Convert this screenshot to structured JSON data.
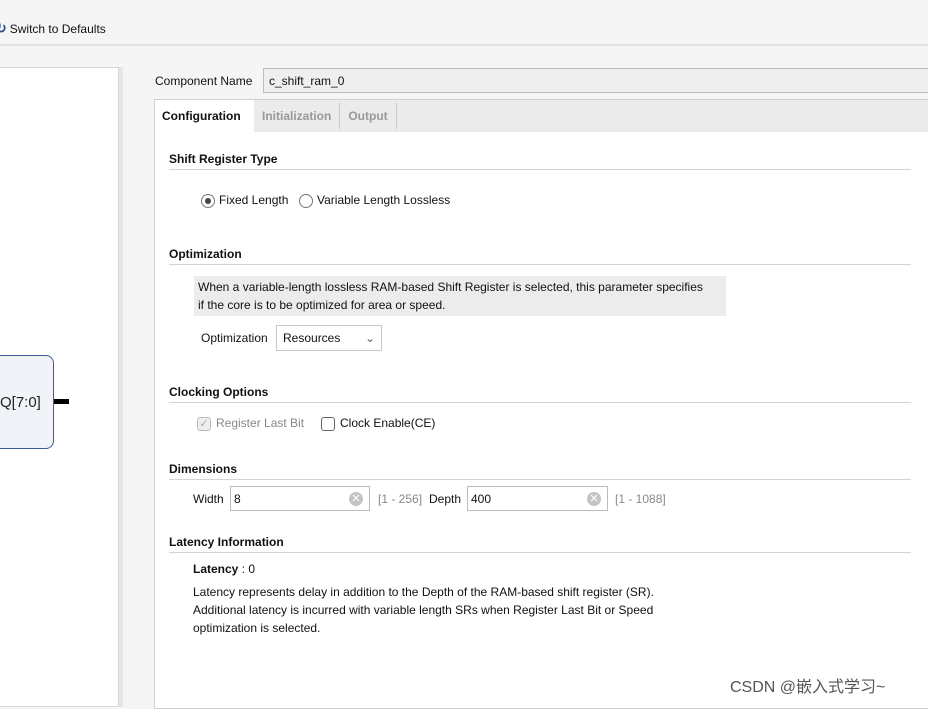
{
  "toolbar": {
    "switch_defaults": "Switch to Defaults"
  },
  "symbol": {
    "port": "Q[7:0]"
  },
  "component": {
    "label": "Component Name",
    "value": "c_shift_ram_0"
  },
  "tabs": [
    {
      "label": "Configuration",
      "active": true
    },
    {
      "label": "Initialization"
    },
    {
      "label": "Output"
    }
  ],
  "shift_register": {
    "title": "Shift Register Type",
    "options": [
      {
        "label": "Fixed Length",
        "selected": true
      },
      {
        "label": "Variable Length Lossless",
        "selected": false
      }
    ]
  },
  "optimization": {
    "title": "Optimization",
    "desc1": "When a variable-length lossless RAM-based Shift Register is selected, this parameter specifies",
    "desc2": "if the core is to be optimized for area or speed.",
    "label": "Optimization",
    "value": "Resources"
  },
  "clocking": {
    "title": "Clocking Options",
    "register_last_bit": {
      "label": "Register Last Bit",
      "checked": true,
      "disabled": true
    },
    "clock_enable": {
      "label": "Clock Enable(CE)",
      "checked": false
    }
  },
  "dimensions": {
    "title": "Dimensions",
    "width_label": "Width",
    "width_value": "8",
    "width_range": "[1 - 256]",
    "depth_label": "Depth",
    "depth_value": "400",
    "depth_range": "[1 - 1088]"
  },
  "latency": {
    "title": "Latency Information",
    "label": "Latency",
    "value": ": 0",
    "line1": "Latency represents delay in addition to the Depth of the RAM-based shift register (SR).",
    "line2": "Additional latency is incurred with variable length SRs when Register Last Bit or Speed",
    "line3": "optimization is selected."
  },
  "watermark": "CSDN @嵌入式学习~"
}
